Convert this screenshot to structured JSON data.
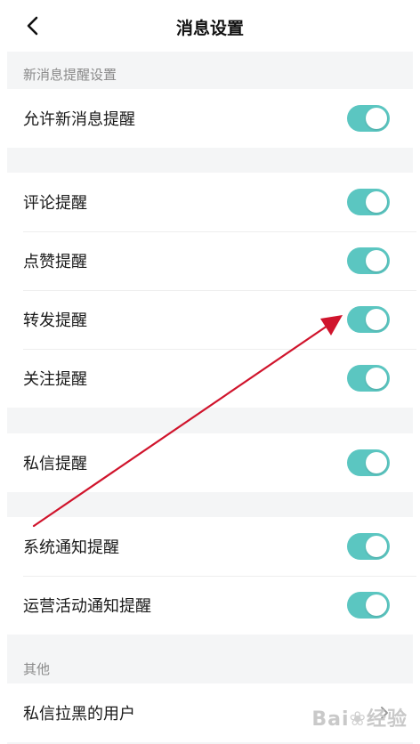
{
  "header": {
    "title": "消息设置",
    "back_icon": "chevron-left-icon"
  },
  "sections": {
    "new_message_label": "新消息提醒设置",
    "other_label": "其他"
  },
  "groups": {
    "allow": {
      "label": "允许新消息提醒",
      "enabled": true
    },
    "interactions": [
      {
        "label": "评论提醒",
        "enabled": true
      },
      {
        "label": "点赞提醒",
        "enabled": true
      },
      {
        "label": "转发提醒",
        "enabled": true
      },
      {
        "label": "关注提醒",
        "enabled": true
      }
    ],
    "private_message": {
      "label": "私信提醒",
      "enabled": true
    },
    "system": [
      {
        "label": "系统通知提醒",
        "enabled": true
      },
      {
        "label": "运营活动通知提醒",
        "enabled": true
      }
    ],
    "blocked": {
      "label": "私信拉黑的用户",
      "icon": "chevron-right-icon"
    }
  },
  "colors": {
    "toggle_on": "#5bc6c1",
    "annotation_arrow": "#d0142c"
  },
  "watermark": {
    "text": "Bai",
    "suffix": "经验"
  }
}
